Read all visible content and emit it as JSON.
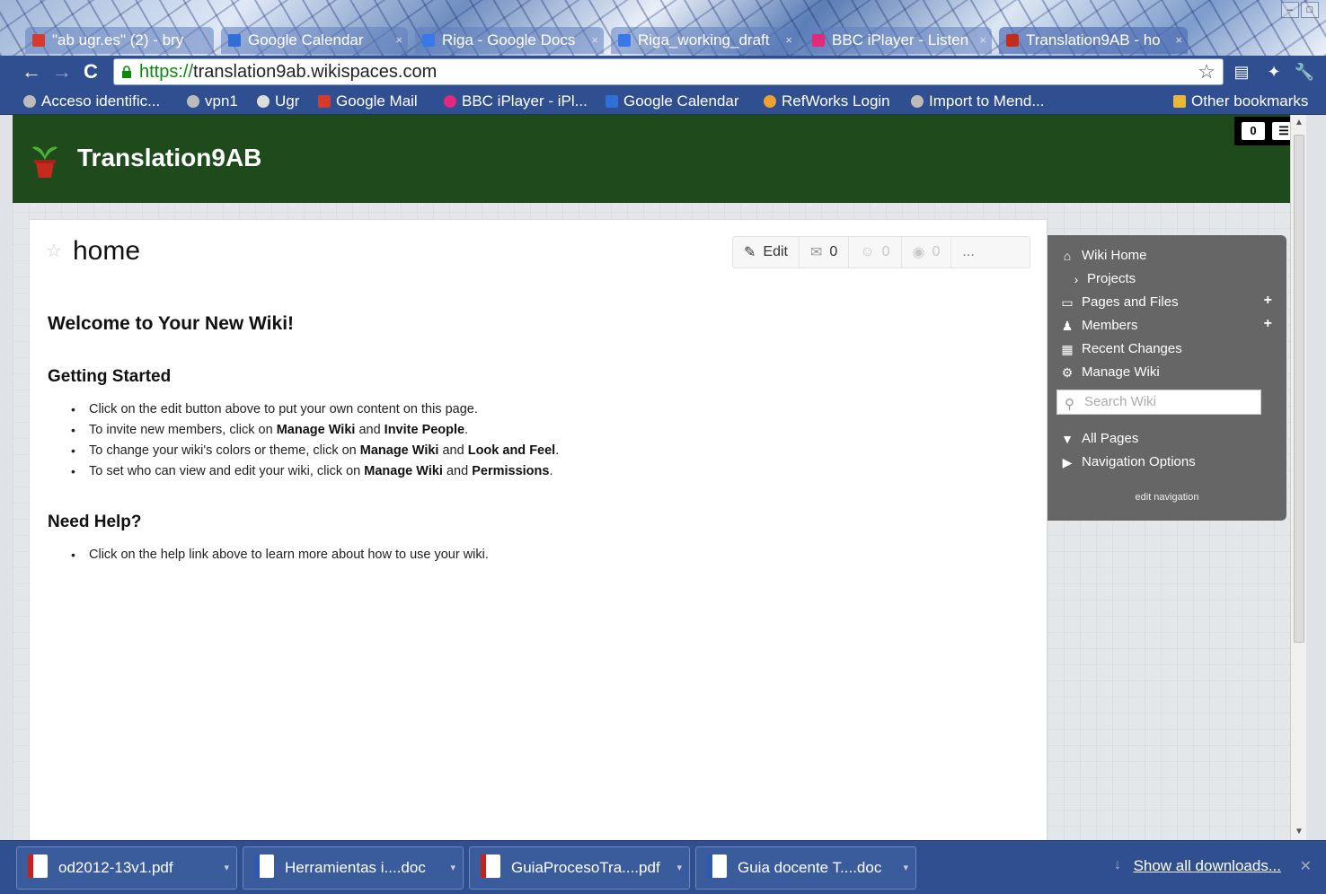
{
  "browser": {
    "tabs": [
      {
        "label": "\"ab ugr.es\" (2) - bry",
        "icon": "gmail-icon",
        "color": "#d23b2e"
      },
      {
        "label": "Google Calendar",
        "icon": "calendar-icon",
        "color": "#2f6fd6"
      },
      {
        "label": "Riga - Google Docs",
        "icon": "docs-icon",
        "color": "#3b78e7"
      },
      {
        "label": "Riga_working_draft",
        "icon": "docs-icon",
        "color": "#3b78e7"
      },
      {
        "label": "BBC iPlayer - Listen",
        "icon": "iplayer-icon",
        "color": "#e2297b"
      },
      {
        "label": "Translation9AB - ho",
        "icon": "wikispaces-icon",
        "color": "#c22d1f"
      }
    ],
    "address": {
      "scheme": "https://",
      "host": "translation9ab.wikispaces.com"
    },
    "bookmarks": [
      {
        "label": "Acceso identific...",
        "icon": "globe-icon",
        "color": "#bbbbbb"
      },
      {
        "label": "vpn1",
        "icon": "globe-icon",
        "color": "#bbbbbb"
      },
      {
        "label": "Ugr",
        "icon": "ugr-icon",
        "color": "#dddddd"
      },
      {
        "label": "Google Mail",
        "icon": "gmail-icon",
        "color": "#d23b2e"
      },
      {
        "label": "BBC iPlayer - iPl...",
        "icon": "iplayer-icon",
        "color": "#e2297b"
      },
      {
        "label": "Google Calendar",
        "icon": "calendar-icon",
        "color": "#2f6fd6"
      },
      {
        "label": "RefWorks Login",
        "icon": "refworks-icon",
        "color": "#f0a030"
      },
      {
        "label": "Import to Mend...",
        "icon": "globe-icon",
        "color": "#bbbbbb"
      }
    ],
    "other_bookmarks": "Other bookmarks"
  },
  "site": {
    "title": "Translation9AB",
    "header_badge": "0"
  },
  "page": {
    "name": "home",
    "actions": {
      "edit": "Edit",
      "comments": "0",
      "likes": "0",
      "follows": "0",
      "more": "..."
    }
  },
  "wiki": {
    "heading": "Welcome to Your New Wiki!",
    "getting_started": "Getting Started",
    "items": [
      {
        "a": "Click on the edit button above to put your own content on this page.",
        "b1": "",
        "m": "",
        "b2": "",
        "e": ""
      },
      {
        "a": "To invite new members, click on ",
        "b1": "Manage Wiki",
        "m": " and ",
        "b2": "Invite People",
        "e": "."
      },
      {
        "a": "To change your wiki's colors or theme, click on ",
        "b1": "Manage Wiki",
        "m": " and ",
        "b2": "Look and Feel",
        "e": "."
      },
      {
        "a": "To set who can view and edit your wiki, click on ",
        "b1": "Manage Wiki",
        "m": " and ",
        "b2": "Permissions",
        "e": "."
      }
    ],
    "need_help": "Need Help?",
    "help_item": "Click on the help link above to learn more about how to use your wiki."
  },
  "sidebar": {
    "wiki_home": "Wiki Home",
    "projects": "Projects",
    "pages_and_files": "Pages and Files",
    "members": "Members",
    "recent_changes": "Recent Changes",
    "manage_wiki": "Manage Wiki",
    "search_placeholder": "Search Wiki",
    "all_pages": "All Pages",
    "navigation_options": "Navigation Options",
    "edit_navigation": "edit navigation"
  },
  "downloads": {
    "files": [
      {
        "name": "od2012-13v1.pdf",
        "type": "pdf"
      },
      {
        "name": "Herramientas i....doc",
        "type": "doc"
      },
      {
        "name": "GuiaProcesoTra....pdf",
        "type": "pdf"
      },
      {
        "name": "Guia docente T....doc",
        "type": "doc"
      }
    ],
    "show_all": "Show all downloads..."
  }
}
